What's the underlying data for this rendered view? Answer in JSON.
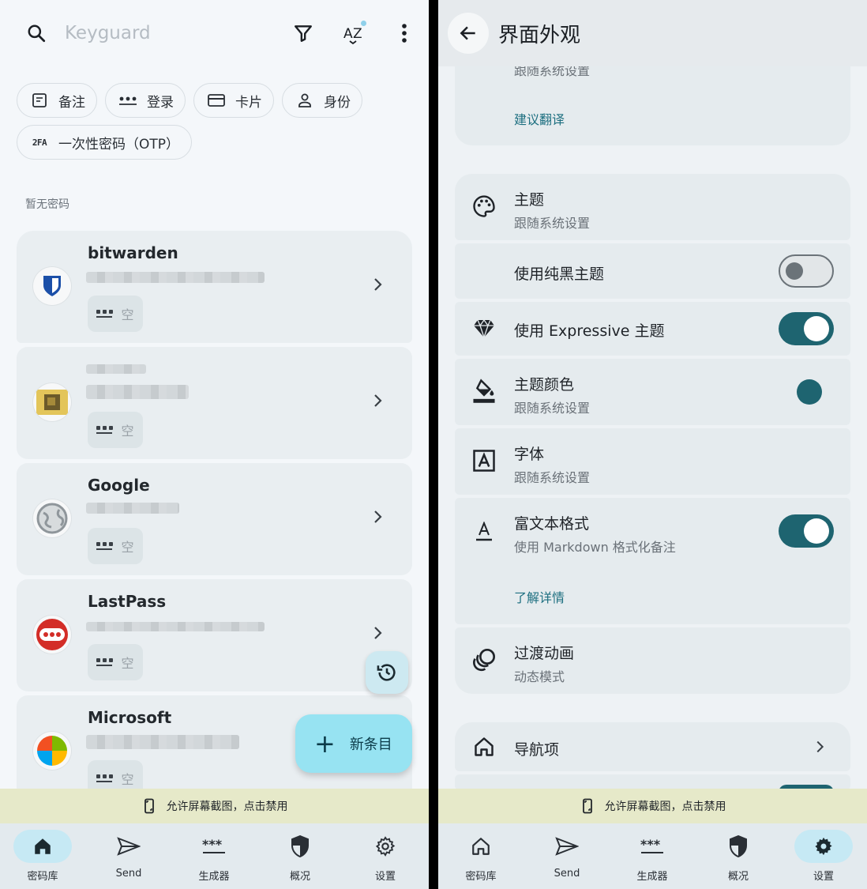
{
  "left": {
    "search": {
      "placeholder": "Keyguard"
    },
    "chips": [
      {
        "label": "备注",
        "icon": "note-icon"
      },
      {
        "label": "登录",
        "icon": "password-dots-icon"
      },
      {
        "label": "卡片",
        "icon": "card-icon"
      },
      {
        "label": "身份",
        "icon": "person-icon"
      },
      {
        "label": "一次性密码（OTP）",
        "icon": "2fa-icon",
        "mark": "2FA"
      }
    ],
    "section_label": "暂无密码",
    "entries": [
      {
        "title": "bitwarden",
        "badge": "空",
        "avatar": "bitwarden-logo-icon"
      },
      {
        "title": "",
        "badge": "空",
        "avatar": "blurred-logo-icon"
      },
      {
        "title": "Google",
        "badge": "空",
        "avatar": "globe-icon"
      },
      {
        "title": "LastPass",
        "badge": "空",
        "avatar": "lastpass-logo-icon"
      },
      {
        "title": "Microsoft",
        "badge": "空",
        "avatar": "microsoft-logo-icon"
      }
    ],
    "fab": {
      "label": "新条目"
    },
    "banner": "允许屏幕截图，点击禁用",
    "nav": [
      {
        "label": "密码库",
        "icon": "home-icon",
        "active": true
      },
      {
        "label": "Send",
        "icon": "send-icon",
        "active": false
      },
      {
        "label": "生成器",
        "icon": "password-generator-icon",
        "active": false
      },
      {
        "label": "概况",
        "icon": "shield-icon",
        "active": false
      },
      {
        "label": "设置",
        "icon": "gear-icon",
        "active": false
      }
    ]
  },
  "right": {
    "title": "界面外观",
    "partial_subtitle": "跟随系统设置",
    "suggest_translation": "建议翻译",
    "settings": {
      "theme": {
        "title": "主题",
        "subtitle": "跟随系统设置"
      },
      "pure_black": {
        "title": "使用纯黑主题",
        "value": false
      },
      "expressive": {
        "title": "使用 Expressive 主题",
        "value": true
      },
      "theme_color": {
        "title": "主题颜色",
        "subtitle": "跟随系统设置",
        "color": "#1e6470"
      },
      "font": {
        "title": "字体",
        "subtitle": "跟随系统设置"
      },
      "rich_text": {
        "title": "富文本格式",
        "subtitle": "使用 Markdown 格式化备注",
        "value": true,
        "link": "了解详情"
      },
      "transition": {
        "title": "过渡动画",
        "subtitle": "动态模式"
      },
      "nav_items": {
        "title": "导航项"
      }
    },
    "banner": "允许屏幕截图，点击禁用",
    "nav": [
      {
        "label": "密码库",
        "icon": "home-icon",
        "active": false
      },
      {
        "label": "Send",
        "icon": "send-icon",
        "active": false
      },
      {
        "label": "生成器",
        "icon": "password-generator-icon",
        "active": false
      },
      {
        "label": "概况",
        "icon": "shield-icon",
        "active": false
      },
      {
        "label": "设置",
        "icon": "gear-icon",
        "active": true
      }
    ]
  },
  "colors": {
    "accent": "#1e6470",
    "fab": "#97e3f2",
    "banner": "#e6e9c9",
    "link": "#1d6f80"
  }
}
